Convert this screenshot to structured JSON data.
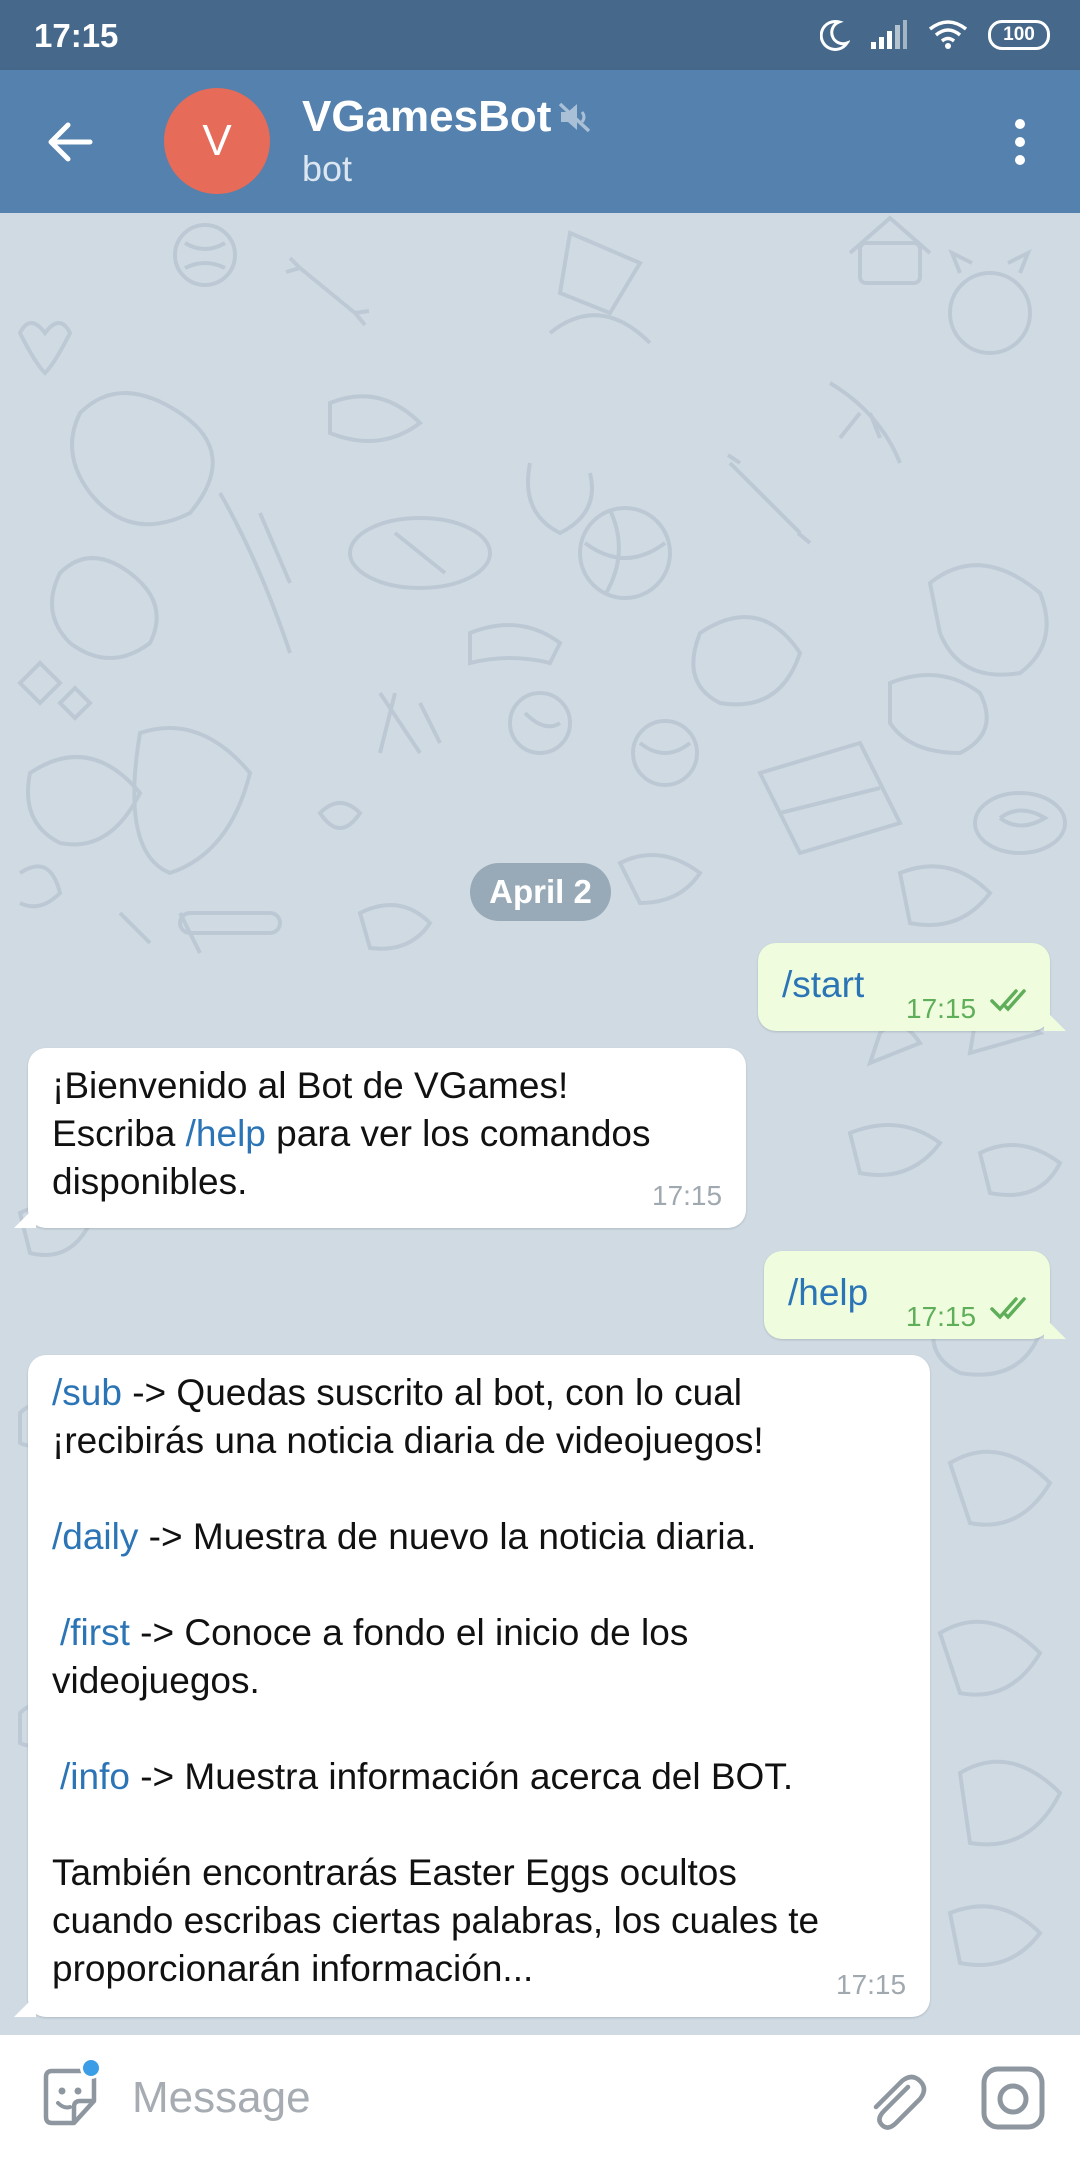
{
  "status_bar": {
    "time": "17:15",
    "battery": "100"
  },
  "header": {
    "title": "VGamesBot",
    "subtitle": "bot",
    "avatar_letter": "V"
  },
  "chat": {
    "date_separator": "April 2",
    "messages": [
      {
        "direction": "outgoing",
        "text": "/start",
        "time": "17:15",
        "status": "read"
      },
      {
        "direction": "incoming",
        "line1": "¡Bienvenido al Bot de VGames!",
        "line2_before": "Escriba ",
        "line2_cmd": "/help",
        "line2_after": " para ver los comandos",
        "line3": "disponibles.",
        "time": "17:15"
      },
      {
        "direction": "outgoing",
        "text": "/help",
        "time": "17:15",
        "status": "read"
      },
      {
        "direction": "incoming",
        "sub_cmd": "/sub",
        "sub_line1": " -> Quedas suscrito al bot, con lo cual",
        "sub_line2": "¡recibirás una noticia diaria de videojuegos!",
        "daily_cmd": "/daily",
        "daily_text": " -> Muestra de nuevo la noticia diaria.",
        "first_cmd": "/first",
        "first_line1": " -> Conoce a fondo el inicio de los",
        "first_line2": "videojuegos.",
        "info_cmd": "/info",
        "info_text": " -> Muestra información acerca del BOT.",
        "easter_line1": "También encontrarás Easter Eggs ocultos",
        "easter_line2": "cuando escribas ciertas palabras, los cuales te",
        "easter_line3": "proporcionarán información...",
        "time": "17:15"
      }
    ]
  },
  "input": {
    "placeholder": "Message"
  },
  "colors": {
    "header": "#5481ad",
    "status_bar": "#46698b",
    "avatar": "#e66b59",
    "outgoing_bubble": "#effdde",
    "command_link": "#2b74b6",
    "read_check": "#5fae5a"
  }
}
